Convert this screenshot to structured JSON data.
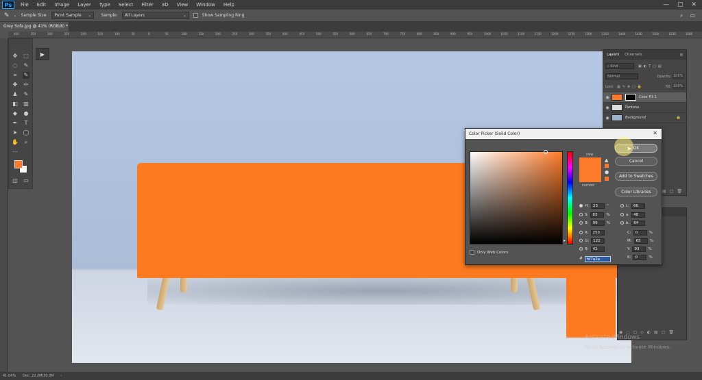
{
  "app": {
    "logo": "Ps"
  },
  "menu": [
    "File",
    "Edit",
    "Image",
    "Layer",
    "Type",
    "Select",
    "Filter",
    "3D",
    "View",
    "Window",
    "Help"
  ],
  "options": {
    "sample_size_label": "Sample Size:",
    "sample_size_value": "Point Sample",
    "sample_label": "Sample:",
    "sample_value": "All Layers",
    "sampling_ring_label": "Show Sampling Ring"
  },
  "document_tab": "Grey Sofa.jpg @ 41% (RGB/8) *",
  "ruler_ticks": [
    "400",
    "350",
    "300",
    "250",
    "200",
    "150",
    "100",
    "50",
    "0",
    "50",
    "100",
    "150",
    "200",
    "250",
    "300",
    "350",
    "400",
    "450",
    "500",
    "550",
    "600",
    "650",
    "700",
    "750",
    "800",
    "850",
    "900",
    "950",
    "1000",
    "1050",
    "1100",
    "1150",
    "1200",
    "1250",
    "1300",
    "1350",
    "1400",
    "1450",
    "1500",
    "1550",
    "1600"
  ],
  "layers_panel": {
    "tabs": [
      "Layers",
      "Channels"
    ],
    "kind_label": "Kind",
    "blend_mode": "Normal",
    "opacity_label": "Opacity:",
    "opacity_value": "100%",
    "lock_label": "Lock:",
    "fill_label": "Fill:",
    "fill_value": "100%",
    "layers": [
      {
        "name": "Color Fill 1",
        "selected": true
      },
      {
        "name": "Pantone",
        "selected": false
      },
      {
        "name": "Background",
        "selected": false
      }
    ]
  },
  "color_picker": {
    "title": "Color Picker (Solid Color)",
    "new_label": "new",
    "current_label": "current",
    "buttons": {
      "ok": "OK",
      "cancel": "Cancel",
      "add_swatches": "Add to Swatches",
      "libraries": "Color Libraries"
    },
    "hsb": [
      {
        "label": "H:",
        "value": "23",
        "unit": "°",
        "selected": true
      },
      {
        "label": "S:",
        "value": "83",
        "unit": "%",
        "selected": false
      },
      {
        "label": "B:",
        "value": "99",
        "unit": "%",
        "selected": false
      }
    ],
    "rgb": [
      {
        "label": "R:",
        "value": "253"
      },
      {
        "label": "G:",
        "value": "122"
      },
      {
        "label": "B:",
        "value": "42"
      }
    ],
    "lab": [
      {
        "label": "L:",
        "value": "66"
      },
      {
        "label": "a:",
        "value": "48"
      },
      {
        "label": "b:",
        "value": "64"
      }
    ],
    "cmyk": [
      {
        "label": "C:",
        "value": "0",
        "unit": "%"
      },
      {
        "label": "M:",
        "value": "65",
        "unit": "%"
      },
      {
        "label": "Y:",
        "value": "93",
        "unit": "%"
      },
      {
        "label": "K:",
        "value": "0",
        "unit": "%"
      }
    ],
    "hex_label": "#",
    "hex_value": "fd7a2a",
    "web_colors_label": "Only Web Colors",
    "selected_color": "#fd7a2a"
  },
  "status": {
    "zoom": "41.04%",
    "doc": "Doc: 22.2M/30.3M"
  },
  "watermark": {
    "line1": "Activate Windows",
    "line2": "Go to Settings to activate Windows."
  }
}
